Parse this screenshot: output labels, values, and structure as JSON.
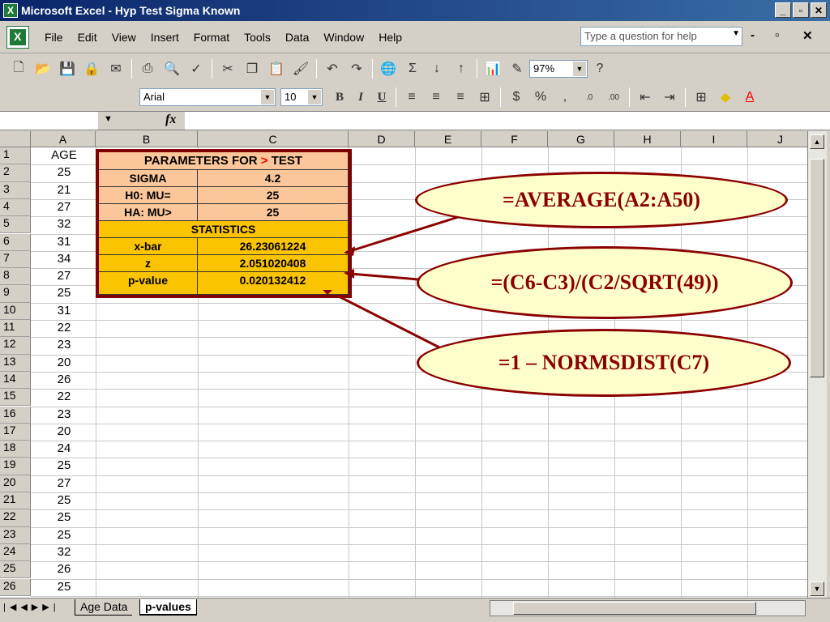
{
  "window": {
    "title": "Microsoft Excel - Hyp  Test Sigma  Known",
    "minimize": "_",
    "restore": "▫",
    "close": "✕"
  },
  "menu": {
    "items": [
      "File",
      "Edit",
      "View",
      "Insert",
      "Format",
      "Tools",
      "Data",
      "Window",
      "Help"
    ],
    "help_placeholder": "Type a question for help"
  },
  "toolbar": {
    "zoom": "97%",
    "font": "Arial",
    "font_size": "10"
  },
  "columns": [
    "A",
    "B",
    "C",
    "D",
    "E",
    "F",
    "G",
    "H",
    "I",
    "J"
  ],
  "rows": [
    "1",
    "2",
    "3",
    "4",
    "5",
    "6",
    "7",
    "8",
    "9",
    "10",
    "11",
    "12",
    "13",
    "14",
    "15",
    "16",
    "17",
    "18",
    "19",
    "20",
    "21",
    "22",
    "23",
    "24",
    "25",
    "26"
  ],
  "ages": [
    "AGE",
    "25",
    "21",
    "27",
    "32",
    "31",
    "34",
    "27",
    "25",
    "31",
    "22",
    "23",
    "20",
    "26",
    "22",
    "23",
    "20",
    "24",
    "25",
    "27",
    "25",
    "25",
    "25",
    "32",
    "26",
    "25"
  ],
  "params": {
    "header_a": "PARAMETERS FOR ",
    "header_gt": ">",
    "header_b": " TEST",
    "sigma_label": "SIGMA",
    "sigma_value": "4.2",
    "h0_label": "H0:  MU=",
    "h0_value": "25",
    "ha_label": "HA:  MU>",
    "ha_value": "25",
    "stats_header": "STATISTICS",
    "xbar_label": "x-bar",
    "xbar_value": "26.23061224",
    "z_label": "z",
    "z_value": "2.051020408",
    "p_label": "p-value",
    "p_value": "0.020132412"
  },
  "callouts": {
    "average": "=AVERAGE(A2:A50)",
    "z_formula": "=(C6-C3)/(C2/SQRT(49))",
    "p_formula": "=1 – NORMSDIST(C7)"
  },
  "sheets": {
    "tab1": "Age Data",
    "tab2": "p-values"
  },
  "colors": {
    "title_bar": "#0a246a",
    "box_border": "#800000",
    "peach": "#fbc79a",
    "gold": "#fbc400",
    "callout_fill": "#ffffcc"
  }
}
